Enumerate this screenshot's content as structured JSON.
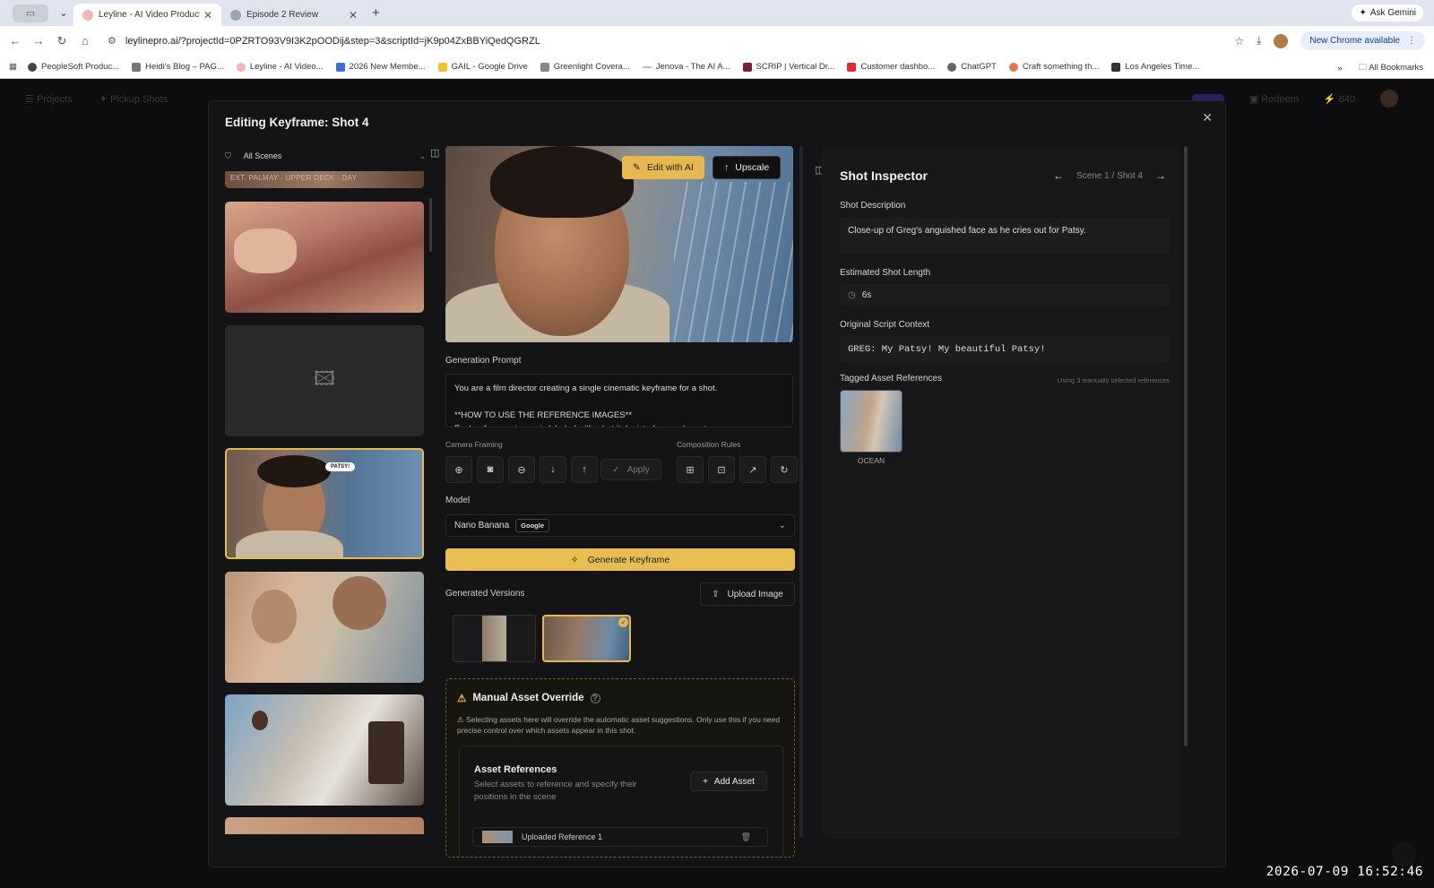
{
  "browser": {
    "tabs": [
      {
        "title": "Leyline - AI Video Production",
        "active": true
      },
      {
        "title": "Episode 2 Review",
        "active": false
      }
    ],
    "url": "leylinepro.ai/?projectId=0PZRTO93V9I3K2pOODij&step=3&scriptId=jK9p04ZxBBYiQedQGRZL",
    "ask_gemini": "Ask Gemini",
    "chrome_update": "New Chrome available",
    "bookmarks": [
      "PeopleSoft Produc...",
      "Heidi's Blog – PAG...",
      "Leyline - AI Video...",
      "2026 New Membe...",
      "GAIL - Google Drive",
      "Greenlight Covera...",
      "Jenova - The AI A...",
      "SCRIP | Vertical Dr...",
      "Customer dashbo...",
      "ChatGPT",
      "Craft something th...",
      "Los Angeles Time..."
    ],
    "all_bookmarks": "All Bookmarks"
  },
  "app_nav": {
    "left": [
      "Projects",
      "Pickup Shots"
    ],
    "right": [
      "Redeem",
      "640"
    ]
  },
  "modal": {
    "title": "Editing Keyframe: Shot 4",
    "filter_label": "All Scenes",
    "strip_label": "EXT. PALMAY - UPPER DECK - DAY",
    "selected_bubble": "PATSY!",
    "preview_buttons": {
      "edit_ai": "Edit with AI",
      "upscale": "Upscale"
    },
    "generation_prompt_label": "Generation Prompt",
    "generation_prompt": "You are a film director creating a single cinematic keyframe for a shot.\n\n**HOW TO USE THE REFERENCE IMAGES**\nEach reference image is labeled with what it depicts (e.g. a character, prop",
    "camera_framing_label": "Camera Framing",
    "composition_rules_label": "Composition Rules",
    "apply_label": "Apply",
    "model_label": "Model",
    "model_value": "Nano Banana",
    "model_badge": "Google",
    "generate_label": "Generate Keyframe",
    "generated_versions_label": "Generated Versions",
    "upload_label": "Upload Image",
    "override": {
      "title": "Manual Asset Override",
      "text": "Selecting assets here will override the automatic asset suggestions. Only use this if you need precise control over which assets appear in this shot.",
      "asset_refs_title": "Asset References",
      "asset_refs_text": "Select assets to reference and specify their positions in the scene",
      "add_asset": "Add Asset",
      "item_label": "Uploaded Reference 1"
    }
  },
  "inspector": {
    "title": "Shot Inspector",
    "nav_label": "Scene 1 / Shot 4",
    "shot_description_label": "Shot Description",
    "shot_description": "Close-up of Greg's anguished face as he cries out for Patsy.",
    "shot_length_label": "Estimated Shot Length",
    "shot_length": "6s",
    "script_context_label": "Original Script Context",
    "script_context": "GREG: My Patsy! My beautiful Patsy!",
    "tagged_assets_label": "Tagged Asset References",
    "tagged_assets_note": "Using 3 manually selected references",
    "asset_name": "OCEAN"
  },
  "timestamp": "2026-07-09  16:52:46",
  "colors": {
    "accent": "#e8bd52",
    "modal_bg": "#141416",
    "panel_bg": "#18181a"
  }
}
